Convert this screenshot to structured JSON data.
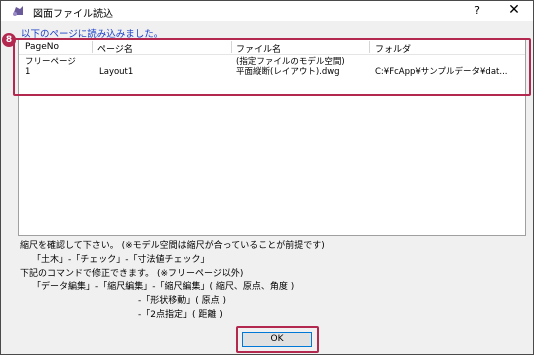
{
  "window": {
    "title": "図面ファイル読込",
    "help_label": "?",
    "close_label": "✕"
  },
  "message": "以下のページに読み込みました。",
  "badge": "8",
  "table": {
    "columns": [
      "PageNo",
      "ページ名",
      "ファイル名",
      "フォルダ"
    ],
    "rows": [
      {
        "page_no": [
          "フリーページ",
          "1"
        ],
        "page_name": "Layout1",
        "file_name": [
          "(指定ファイルのモデル空間)",
          "平面縦断(レイアウト).dwg"
        ],
        "folder": "C:¥FcApp¥サンプルデータ¥dat..."
      }
    ]
  },
  "notes": [
    "縮尺を確認して下さい。 (※モデル空間は縮尺が合っていることが前提です)",
    "「土木」-「チェック」-「寸法値チェック」",
    "下記のコマンドで修正できます。 (※フリーページ以外)",
    "「データ編集」-「縮尺編集」-「縮尺編集」( 縮尺、原点、角度 )",
    "-「形状移動」( 原点 )",
    "-「2点指定」( 距離 )"
  ],
  "ok_label": "OK",
  "colors": {
    "highlight": "#b3284f",
    "message": "#1a3fc9"
  }
}
